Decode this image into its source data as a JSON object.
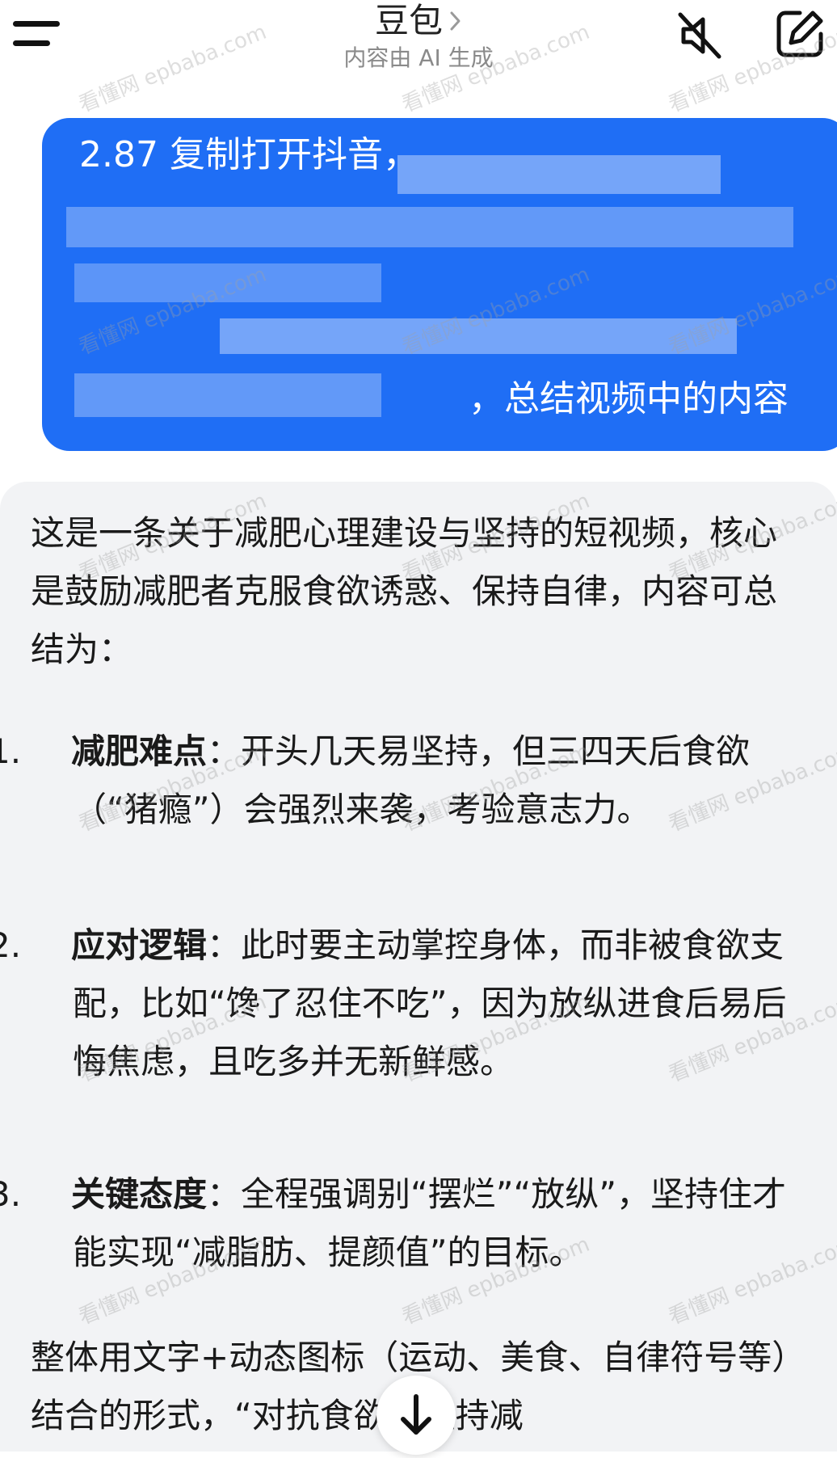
{
  "header": {
    "title": "豆包",
    "subtitle": "内容由 AI 生成"
  },
  "user_message": {
    "first_visible": "2.87 复制打开抖音，",
    "last_visible": "，总结视频中的内容"
  },
  "answer": {
    "intro": "这是一条关于减肥心理建设与坚持的短视频，核心是鼓励减肥者克服食欲诱惑、保持自律，内容可总结为：",
    "items": [
      {
        "number": "1.",
        "title": "减肥难点",
        "body": "：开头几天易坚持，但三四天后食欲（“猪瘾”）会强烈来袭，考验意志力。"
      },
      {
        "number": "2.",
        "title": "应对逻辑",
        "body": "：此时要主动掌控身体，而非被食欲支配，比如“馋了忍住不吃”，因为放纵进食后易后悔焦虑，且吃多并无新鲜感。"
      },
      {
        "number": "3.",
        "title": "关键态度",
        "body": "：全程强调别“摆烂”“放纵”，坚持住才能实现“减脂肪、提颜值”的目标。"
      }
    ],
    "outro": "整体用文字+动态图标（运动、美食、自律符号等）结合的形式，“对抗食欲、坚持减"
  },
  "watermark": {
    "cn": "看懂网",
    "en": "epbaba.com"
  },
  "colors": {
    "accent": "#1f6ef5",
    "answer_bg": "#f2f3f5"
  },
  "icons": [
    "menu-icon",
    "chevron-right-icon",
    "mute-icon",
    "edit-icon",
    "arrow-down-icon"
  ]
}
